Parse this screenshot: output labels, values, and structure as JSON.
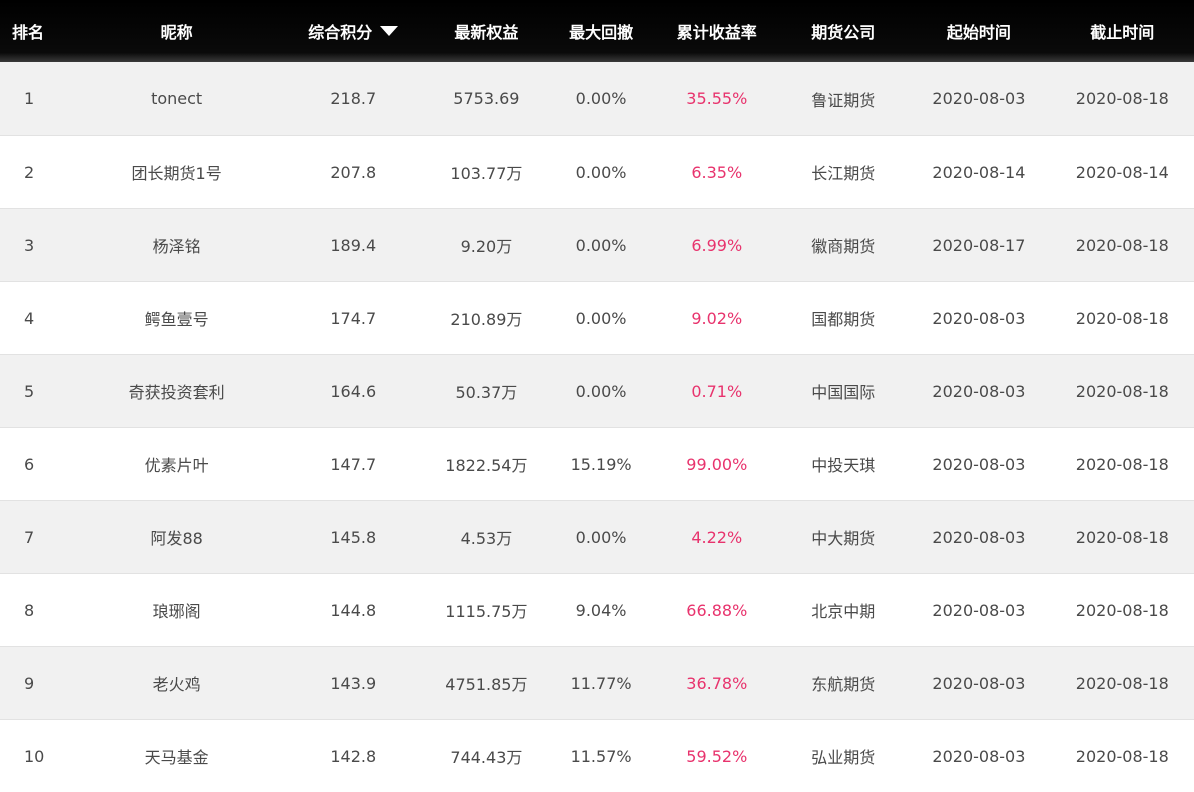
{
  "headers": {
    "rank": "排名",
    "nickname": "昵称",
    "score": "综合积分",
    "equity": "最新权益",
    "drawdown": "最大回撤",
    "return_rate": "累计收益率",
    "company": "期货公司",
    "start": "起始时间",
    "end": "截止时间"
  },
  "sort": {
    "column": "score",
    "direction": "desc",
    "icon": "caret-down-icon"
  },
  "colors": {
    "header_bg": "#000000",
    "header_text": "#ffffff",
    "rate": "#e8336d",
    "stripe": "#f1f1f1",
    "text": "#4a4a4a"
  },
  "rows": [
    {
      "rank": "1",
      "nickname": "tonect",
      "score": "218.7",
      "equity": "5753.69",
      "drawdown": "0.00%",
      "return_rate": "35.55%",
      "company": "鲁证期货",
      "start": "2020-08-03",
      "end": "2020-08-18"
    },
    {
      "rank": "2",
      "nickname": "团长期货1号",
      "score": "207.8",
      "equity": "103.77万",
      "drawdown": "0.00%",
      "return_rate": "6.35%",
      "company": "长江期货",
      "start": "2020-08-14",
      "end": "2020-08-14"
    },
    {
      "rank": "3",
      "nickname": "杨泽铭",
      "score": "189.4",
      "equity": "9.20万",
      "drawdown": "0.00%",
      "return_rate": "6.99%",
      "company": "徽商期货",
      "start": "2020-08-17",
      "end": "2020-08-18"
    },
    {
      "rank": "4",
      "nickname": "鳄鱼壹号",
      "score": "174.7",
      "equity": "210.89万",
      "drawdown": "0.00%",
      "return_rate": "9.02%",
      "company": "国都期货",
      "start": "2020-08-03",
      "end": "2020-08-18"
    },
    {
      "rank": "5",
      "nickname": "奇获投资套利",
      "score": "164.6",
      "equity": "50.37万",
      "drawdown": "0.00%",
      "return_rate": "0.71%",
      "company": "中国国际",
      "start": "2020-08-03",
      "end": "2020-08-18"
    },
    {
      "rank": "6",
      "nickname": "优素片叶",
      "score": "147.7",
      "equity": "1822.54万",
      "drawdown": "15.19%",
      "return_rate": "99.00%",
      "company": "中投天琪",
      "start": "2020-08-03",
      "end": "2020-08-18"
    },
    {
      "rank": "7",
      "nickname": "阿发88",
      "score": "145.8",
      "equity": "4.53万",
      "drawdown": "0.00%",
      "return_rate": "4.22%",
      "company": "中大期货",
      "start": "2020-08-03",
      "end": "2020-08-18"
    },
    {
      "rank": "8",
      "nickname": "琅琊阁",
      "score": "144.8",
      "equity": "1115.75万",
      "drawdown": "9.04%",
      "return_rate": "66.88%",
      "company": "北京中期",
      "start": "2020-08-03",
      "end": "2020-08-18"
    },
    {
      "rank": "9",
      "nickname": "老火鸡",
      "score": "143.9",
      "equity": "4751.85万",
      "drawdown": "11.77%",
      "return_rate": "36.78%",
      "company": "东航期货",
      "start": "2020-08-03",
      "end": "2020-08-18"
    },
    {
      "rank": "10",
      "nickname": "天马基金",
      "score": "142.8",
      "equity": "744.43万",
      "drawdown": "11.57%",
      "return_rate": "59.52%",
      "company": "弘业期货",
      "start": "2020-08-03",
      "end": "2020-08-18"
    }
  ]
}
